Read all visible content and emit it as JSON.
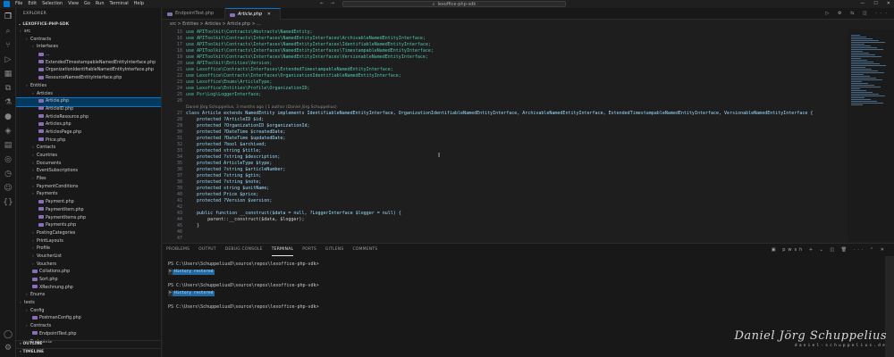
{
  "menu": [
    "File",
    "Edit",
    "Selection",
    "View",
    "Go",
    "Run",
    "Terminal",
    "Help"
  ],
  "window": {
    "search": "lexoffice-php-sdk"
  },
  "sidebar": {
    "header": "EXPLORER",
    "project": "LEXOFFICE-PHP-SDK",
    "items": [
      {
        "label": "src",
        "indent": 0,
        "folder": true
      },
      {
        "label": "Contracts",
        "indent": 1,
        "folder": true
      },
      {
        "label": "Interfaces",
        "indent": 2,
        "folder": true
      },
      {
        "label": "...",
        "indent": 3,
        "folder": false
      },
      {
        "label": "ExtendedTimestampableNamedEntityInterface.php",
        "indent": 3,
        "folder": false
      },
      {
        "label": "OrganizationIdentifiableNamedEntityInterface.php",
        "indent": 3,
        "folder": false
      },
      {
        "label": "ResourceNamedEntityInterface.php",
        "indent": 3,
        "folder": false
      },
      {
        "label": "Entities",
        "indent": 1,
        "folder": true
      },
      {
        "label": "Articles",
        "indent": 2,
        "folder": true
      },
      {
        "label": "Article.php",
        "indent": 3,
        "folder": false,
        "selected": true
      },
      {
        "label": "ArticleID.php",
        "indent": 3,
        "folder": false
      },
      {
        "label": "ArticleResource.php",
        "indent": 3,
        "folder": false
      },
      {
        "label": "Articles.php",
        "indent": 3,
        "folder": false
      },
      {
        "label": "ArticlesPage.php",
        "indent": 3,
        "folder": false
      },
      {
        "label": "Price.php",
        "indent": 3,
        "folder": false
      },
      {
        "label": "Contacts",
        "indent": 2,
        "folder": true
      },
      {
        "label": "Countries",
        "indent": 2,
        "folder": true
      },
      {
        "label": "Documents",
        "indent": 2,
        "folder": true
      },
      {
        "label": "EventSubscriptions",
        "indent": 2,
        "folder": true
      },
      {
        "label": "Files",
        "indent": 2,
        "folder": true
      },
      {
        "label": "PaymentConditions",
        "indent": 2,
        "folder": true
      },
      {
        "label": "Payments",
        "indent": 2,
        "folder": true
      },
      {
        "label": "Payment.php",
        "indent": 3,
        "folder": false
      },
      {
        "label": "PaymentItem.php",
        "indent": 3,
        "folder": false
      },
      {
        "label": "PaymentItems.php",
        "indent": 3,
        "folder": false
      },
      {
        "label": "Payments.php",
        "indent": 3,
        "folder": false
      },
      {
        "label": "PostingCategories",
        "indent": 2,
        "folder": true
      },
      {
        "label": "PrintLayouts",
        "indent": 2,
        "folder": true
      },
      {
        "label": "Profile",
        "indent": 2,
        "folder": true
      },
      {
        "label": "VoucherList",
        "indent": 2,
        "folder": true
      },
      {
        "label": "Vouchers",
        "indent": 2,
        "folder": true
      },
      {
        "label": "Collations.php",
        "indent": 2,
        "folder": false
      },
      {
        "label": "Sort.php",
        "indent": 2,
        "folder": false
      },
      {
        "label": "XRechnung.php",
        "indent": 2,
        "folder": false
      },
      {
        "label": "Enums",
        "indent": 1,
        "folder": true
      },
      {
        "label": "tests",
        "indent": 0,
        "folder": true
      },
      {
        "label": "Config",
        "indent": 1,
        "folder": true
      },
      {
        "label": "PostmanConfig.php",
        "indent": 2,
        "folder": false
      },
      {
        "label": "Contracts",
        "indent": 1,
        "folder": true
      },
      {
        "label": "EndpointTest.php",
        "indent": 2,
        "folder": false
      },
      {
        "label": "Endpoints",
        "indent": 1,
        "folder": true
      }
    ],
    "outline": "OUTLINE",
    "timeline": "TIMELINE"
  },
  "tabs": [
    {
      "label": "EndpointTest.php",
      "active": false
    },
    {
      "label": "Article.php",
      "active": true
    }
  ],
  "breadcrumb": "src > Entities > Articles > Article.php > ...",
  "code": [
    {
      "n": "15",
      "t": "use APIToolkit\\Contracts\\Abstracts\\NamedEntity;"
    },
    {
      "n": "16",
      "t": "use APIToolkit\\Contracts\\Interfaces\\NamedEntityInterfaces\\ArchivableNamedEntityInterface;"
    },
    {
      "n": "17",
      "t": "use APIToolkit\\Contracts\\Interfaces\\NamedEntityInterfaces\\IdentifiableNamedEntityInterface;"
    },
    {
      "n": "18",
      "t": "use APIToolkit\\Contracts\\Interfaces\\NamedEntityInterfaces\\TimestampableNamedEntityInterface;"
    },
    {
      "n": "19",
      "t": "use APIToolkit\\Contracts\\Interfaces\\NamedEntityInterfaces\\VersionableNamedEntityInterface;"
    },
    {
      "n": "20",
      "t": "use APIToolkit\\Entities\\Version;"
    },
    {
      "n": "21",
      "t": "use Lexoffice\\Contracts\\Interfaces\\ExtendedTimestampableNamedEntityInterface;"
    },
    {
      "n": "22",
      "t": "use Lexoffice\\Contracts\\Interfaces\\OrganizationIdentifiableNamedEntityInterface;"
    },
    {
      "n": "23",
      "t": "use Lexoffice\\Enums\\ArticleType;"
    },
    {
      "n": "24",
      "t": "use Lexoffice\\Entities\\Profile\\OrganizationID;"
    },
    {
      "n": "25",
      "t": "use Psr\\Log\\LoggerInterface;"
    },
    {
      "n": "26",
      "t": ""
    },
    {
      "n": "",
      "t": "Daniel Jörg Schuppelius, 3 months ago | 1 author (Daniel Jörg Schuppelius)",
      "lens": true
    },
    {
      "n": "27",
      "t": "class Article extends NamedEntity implements IdentifiableNamedEntityInterface, OrganizationIdentifiableNamedEntityInterface, ArchivableNamedEntityInterface, ExtendedTimestampableNamedEntityInterface, VersionableNamedEntityInterface {"
    },
    {
      "n": "28",
      "t": "    protected ?ArticleID $id;"
    },
    {
      "n": "29",
      "t": "    protected ?OrganizationID $organizationId;"
    },
    {
      "n": "30",
      "t": "    protected ?DateTime $createdDate;"
    },
    {
      "n": "31",
      "t": "    protected ?DateTime $updatedDate;"
    },
    {
      "n": "32",
      "t": "    protected ?bool $archived;"
    },
    {
      "n": "33",
      "t": "    protected string $title;"
    },
    {
      "n": "34",
      "t": "    protected ?string $description;"
    },
    {
      "n": "35",
      "t": "    protected ArticleType $type;"
    },
    {
      "n": "36",
      "t": "    protected ?string $articleNumber;"
    },
    {
      "n": "37",
      "t": "    protected ?string $gtin;"
    },
    {
      "n": "38",
      "t": "    protected ?string $note;"
    },
    {
      "n": "39",
      "t": "    protected string $unitName;"
    },
    {
      "n": "40",
      "t": "    protected Price $price;"
    },
    {
      "n": "41",
      "t": "    protected ?Version $version;"
    },
    {
      "n": "42",
      "t": ""
    },
    {
      "n": "43",
      "t": "    public function __construct($data = null, ?LoggerInterface $logger = null) {"
    },
    {
      "n": "44",
      "t": "        parent::__construct($data, $logger);"
    },
    {
      "n": "45",
      "t": "    }"
    },
    {
      "n": "46",
      "t": ""
    },
    {
      "n": "47",
      "t": ""
    }
  ],
  "panel": {
    "tabs": [
      "PROBLEMS",
      "OUTPUT",
      "DEBUG CONSOLE",
      "TERMINAL",
      "PORTS",
      "GITLENS",
      "COMMENTS"
    ],
    "active": "TERMINAL",
    "shell": "pwsh",
    "lines": [
      {
        "text": "PS C:\\Users\\SchuppeliusD\\source\\repos\\lexoffice-php-sdk>",
        "hist": ""
      },
      {
        "text": "",
        "hist": "History restored"
      },
      {
        "text": "",
        "hist": ""
      },
      {
        "text": "PS C:\\Users\\SchuppeliusD\\source\\repos\\lexoffice-php-sdk>",
        "hist": ""
      },
      {
        "text": "",
        "hist": "History restored"
      },
      {
        "text": "",
        "hist": ""
      },
      {
        "text": "PS C:\\Users\\SchuppeliusD\\source\\repos\\lexoffice-php-sdk>",
        "hist": ""
      }
    ]
  },
  "watermark": {
    "signature": "Daniel Jörg Schuppelius",
    "url": "daniel-schuppelius.de"
  },
  "colors": {
    "accent": "#0078d4",
    "keyword": "#569cd6",
    "type": "#4ec9b0",
    "variable": "#9cdcfe"
  }
}
